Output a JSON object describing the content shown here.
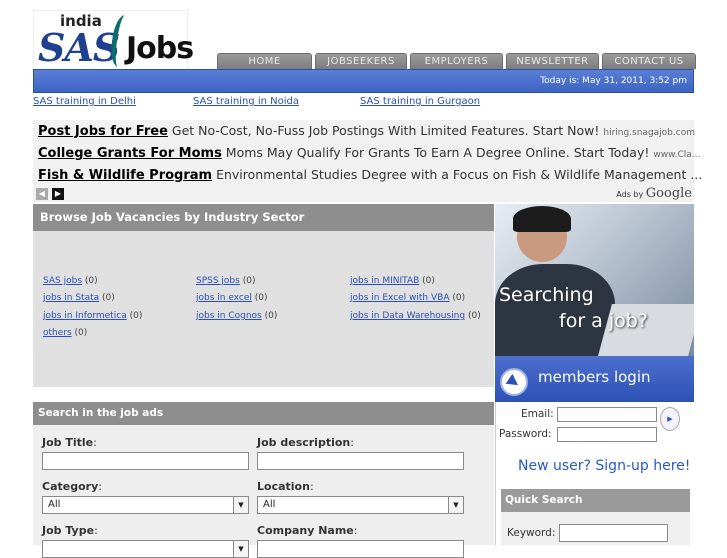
{
  "logo": {
    "india": "india",
    "sas": "SAS",
    "jobs": "Jobs"
  },
  "nav": [
    {
      "label": "HOME"
    },
    {
      "label": "JOBSEEKERS"
    },
    {
      "label": "EMPLOYERS"
    },
    {
      "label": "NEWSLETTER"
    },
    {
      "label": "CONTACT US"
    }
  ],
  "datebar": {
    "text": "Today is: May 31, 2011, 3:52 pm"
  },
  "training_links": [
    "SAS training in Delhi",
    "SAS training in Noida",
    "SAS training in Gurgaon"
  ],
  "ads": [
    {
      "headline": "Post Jobs for Free",
      "text": "Get No-Cost, No-Fuss Job Postings With Limited Features. Start Now!",
      "url": "hiring.snagajob.com"
    },
    {
      "headline": "College Grants For Moms",
      "text": "Moms May Qualify For Grants To Earn A Degree Online. Start Today!",
      "url": "www.Cla..."
    },
    {
      "headline": "Fish & Wildlife Program",
      "text": "Environmental Studies Degree with a Focus on Fish & Wildlife Management ...",
      "url": ""
    }
  ],
  "ads_by": {
    "prefix": "Ads by",
    "brand": "Google"
  },
  "browse": {
    "title": "Browse Job Vacancies by Industry Sector",
    "categories": [
      {
        "label": "SAS jobs",
        "count": "(0)"
      },
      {
        "label": "SPSS jobs",
        "count": "(0)"
      },
      {
        "label": "jobs in MINITAB",
        "count": "(0)"
      },
      {
        "label": "jobs in Stata",
        "count": "(0)"
      },
      {
        "label": "jobs in excel",
        "count": "(0)"
      },
      {
        "label": "jobs in Excel with VBA",
        "count": "(0)"
      },
      {
        "label": "jobs in Informetica",
        "count": "(0)"
      },
      {
        "label": "jobs in Cognos",
        "count": "(0)"
      },
      {
        "label": "jobs in Data Warehousing",
        "count": "(0)"
      },
      {
        "label": "others",
        "count": "(0)"
      }
    ]
  },
  "promo": {
    "line1": "Searching",
    "line2": "for a job?"
  },
  "members": {
    "label": "members login"
  },
  "search": {
    "title": "Search in the job ads",
    "job_title_label": "Job Title",
    "job_desc_label": "Job description",
    "category_label": "Category",
    "category_value": "All",
    "location_label": "Location",
    "location_value": "All",
    "job_type_label": "Job Type",
    "company_label": "Company Name",
    "colon": ":"
  },
  "login": {
    "email_label": "Email:",
    "password_label": "Password:",
    "signup": "New user? Sign-up here!"
  },
  "quick_search": {
    "title": "Quick Search",
    "keyword_label": "Keyword:"
  }
}
